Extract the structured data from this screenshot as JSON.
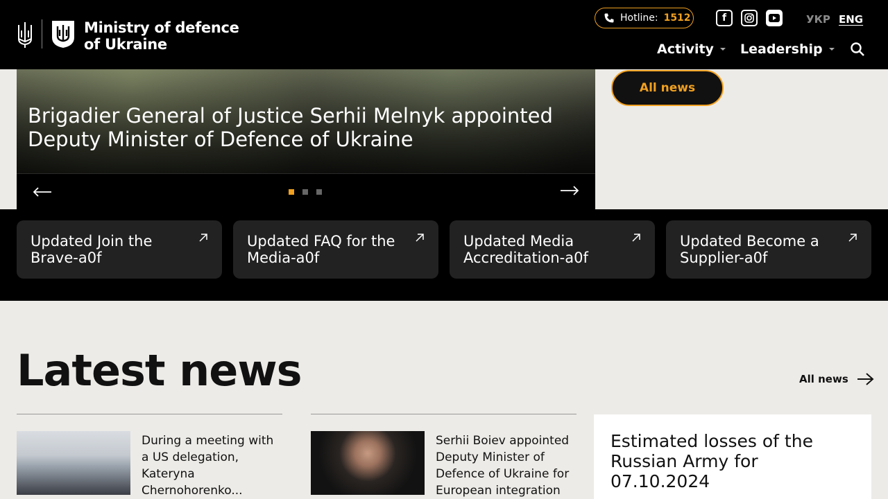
{
  "header": {
    "ministry_line1": "Ministry of defence",
    "ministry_line2": "of Ukraine",
    "hotline_label": "Hotline:",
    "hotline_number": "1512",
    "socials": [
      "facebook-icon",
      "instagram-icon",
      "youtube-icon"
    ],
    "lang_ukr": "УКР",
    "lang_eng": "ENG",
    "nav": [
      {
        "label": "Activity"
      },
      {
        "label": "Leadership"
      }
    ]
  },
  "hero": {
    "title": "Brigadier General of Justice Serhii Melnyk appointed Deputy Minister of Defence of Ukraine",
    "all_news": "All news",
    "slides": 3,
    "active_slide": 1
  },
  "cards": [
    {
      "label": "Updated Join the Brave-a0f"
    },
    {
      "label": "Updated FAQ for the Media-a0f"
    },
    {
      "label": "Updated Media Accreditation-a0f"
    },
    {
      "label": "Updated Become a Supplier-a0f"
    }
  ],
  "latest": {
    "title": "Latest news",
    "all_news": "All news",
    "items": [
      {
        "text": "During a meeting with a US delegation, Kateryna Chernohorenko..."
      },
      {
        "text": "Serhii Boiev appointed Deputy Minister of Defence of Ukraine for European integration"
      }
    ],
    "losses_title": "Estimated losses of the Russian Army for 07.10.2024"
  },
  "colors": {
    "accent": "#f0a020",
    "header_bg": "#000000",
    "page_bg": "#edebe7",
    "card_bg": "#222222"
  }
}
